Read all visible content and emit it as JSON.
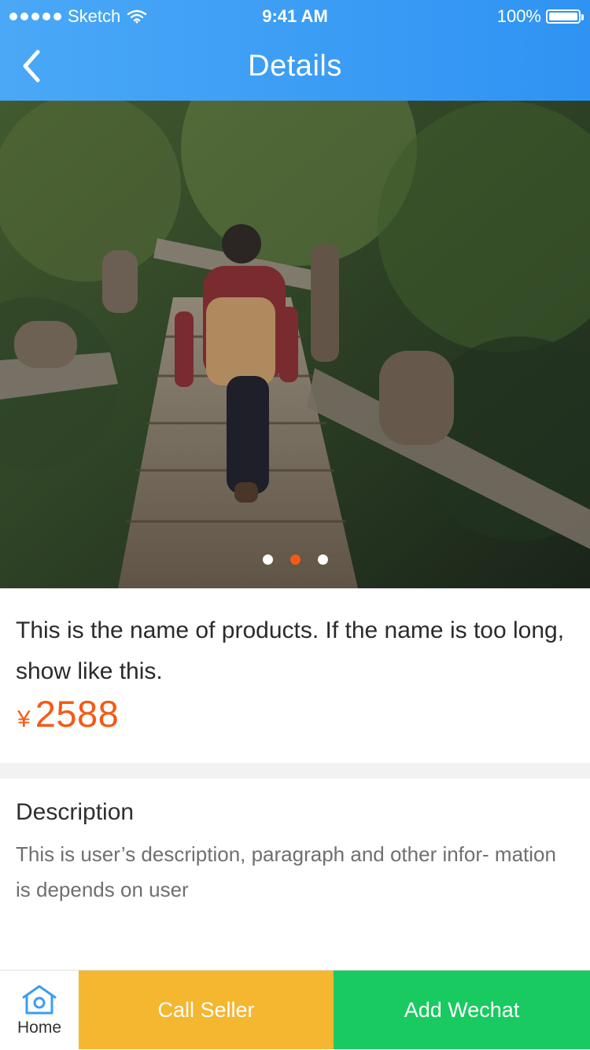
{
  "status_bar": {
    "carrier": "Sketch",
    "time": "9:41 AM",
    "battery_label": "100%",
    "battery_level": 1.0
  },
  "nav": {
    "back_icon": "chevron-left-icon",
    "title": "Details"
  },
  "hero": {
    "image_description": "person with backpack walking down wooden stairs through greenery",
    "pager": {
      "total": 3,
      "active_index": 1,
      "active_color": "#f55a14"
    }
  },
  "product": {
    "name": "This is the name of products. If the name is too long, show like this.",
    "currency": "¥",
    "price": "2588",
    "price_color": "#f55a14"
  },
  "description": {
    "title": "Description",
    "text": "This is user’s description, paragraph and other infor- mation is depends on user"
  },
  "bottom_bar": {
    "home_label": "Home",
    "home_icon": "home-icon",
    "call_label": "Call Seller",
    "call_color": "#f5b630",
    "wechat_label": "Add Wechat",
    "wechat_color": "#18ca60"
  }
}
